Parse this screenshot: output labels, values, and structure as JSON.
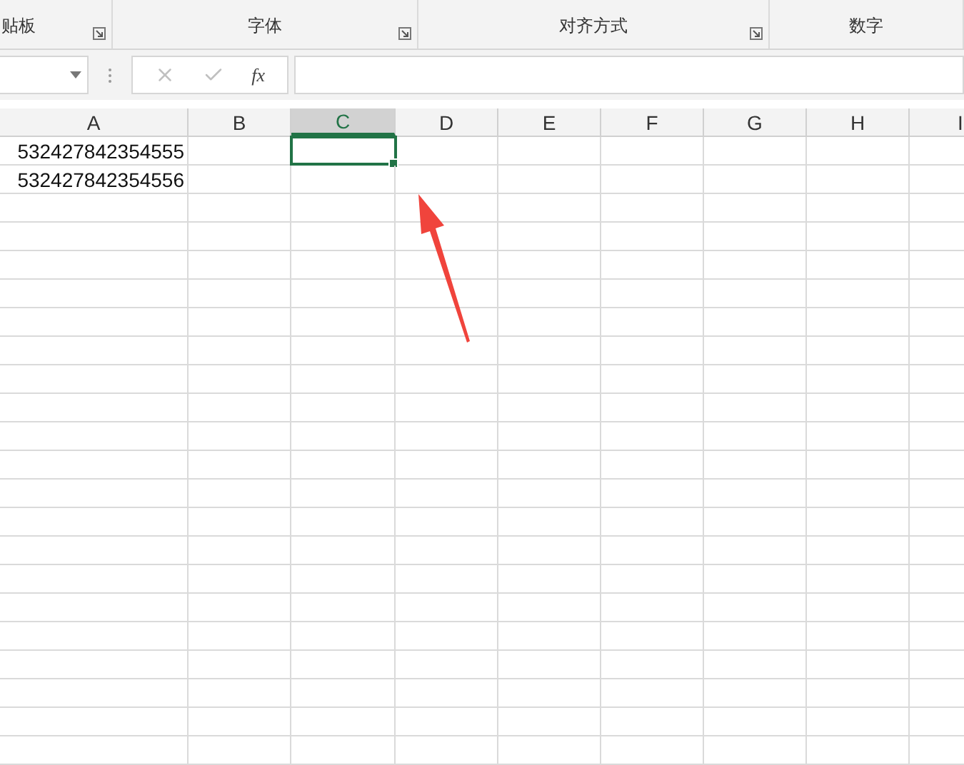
{
  "ribbon_groups": [
    {
      "label": "贴板",
      "launcher": true
    },
    {
      "label": "字体",
      "launcher": true
    },
    {
      "label": "对齐方式",
      "launcher": true
    },
    {
      "label": "数字",
      "launcher": false
    }
  ],
  "formula_bar": {
    "function_label": "fx",
    "cancel_disabled": true,
    "enter_disabled": true
  },
  "columns": [
    {
      "label": "A",
      "selected": false
    },
    {
      "label": "B",
      "selected": false
    },
    {
      "label": "C",
      "selected": true
    },
    {
      "label": "D",
      "selected": false
    },
    {
      "label": "E",
      "selected": false
    },
    {
      "label": "F",
      "selected": false
    },
    {
      "label": "G",
      "selected": false
    },
    {
      "label": "H",
      "selected": false
    },
    {
      "label": "I",
      "selected": false
    }
  ],
  "rows": [
    {
      "cells": [
        "532427842354555"
      ],
      "selected": true
    },
    {
      "cells": [
        "532427842354556"
      ],
      "selected": false
    }
  ],
  "annotation": {
    "kind": "arrow"
  }
}
